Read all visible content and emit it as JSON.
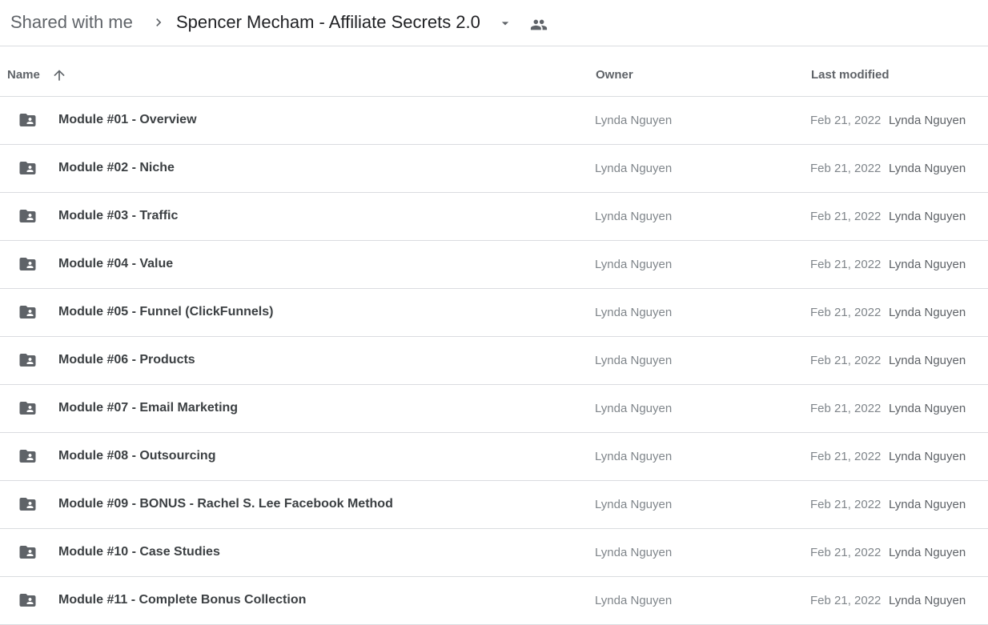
{
  "breadcrumb": {
    "root": "Shared with me",
    "current": "Spencer Mecham - Affiliate Secrets 2.0",
    "separator_icon": "chevron-right-icon",
    "dropdown_icon": "caret-down-icon",
    "shared_icon": "people-icon"
  },
  "columns": {
    "name": "Name",
    "owner": "Owner",
    "last_modified": "Last modified",
    "sort_icon": "arrow-up-icon"
  },
  "colors": {
    "folder_icon": "#5f6368",
    "divider": "#dadce0"
  },
  "files": [
    {
      "name": "Module #01 - Overview",
      "owner": "Lynda Nguyen",
      "date": "Feb 21, 2022",
      "modified_by": "Lynda Nguyen"
    },
    {
      "name": "Module #02 - Niche",
      "owner": "Lynda Nguyen",
      "date": "Feb 21, 2022",
      "modified_by": "Lynda Nguyen"
    },
    {
      "name": "Module #03 - Traffic",
      "owner": "Lynda Nguyen",
      "date": "Feb 21, 2022",
      "modified_by": "Lynda Nguyen"
    },
    {
      "name": "Module #04 - Value",
      "owner": "Lynda Nguyen",
      "date": "Feb 21, 2022",
      "modified_by": "Lynda Nguyen"
    },
    {
      "name": "Module #05 - Funnel (ClickFunnels)",
      "owner": "Lynda Nguyen",
      "date": "Feb 21, 2022",
      "modified_by": "Lynda Nguyen"
    },
    {
      "name": "Module #06 - Products",
      "owner": "Lynda Nguyen",
      "date": "Feb 21, 2022",
      "modified_by": "Lynda Nguyen"
    },
    {
      "name": "Module #07 - Email Marketing",
      "owner": "Lynda Nguyen",
      "date": "Feb 21, 2022",
      "modified_by": "Lynda Nguyen"
    },
    {
      "name": "Module #08 - Outsourcing",
      "owner": "Lynda Nguyen",
      "date": "Feb 21, 2022",
      "modified_by": "Lynda Nguyen"
    },
    {
      "name": "Module #09 - BONUS - Rachel S. Lee Facebook Method",
      "owner": "Lynda Nguyen",
      "date": "Feb 21, 2022",
      "modified_by": "Lynda Nguyen"
    },
    {
      "name": "Module #10 - Case Studies",
      "owner": "Lynda Nguyen",
      "date": "Feb 21, 2022",
      "modified_by": "Lynda Nguyen"
    },
    {
      "name": "Module #11 - Complete Bonus Collection",
      "owner": "Lynda Nguyen",
      "date": "Feb 21, 2022",
      "modified_by": "Lynda Nguyen"
    }
  ]
}
